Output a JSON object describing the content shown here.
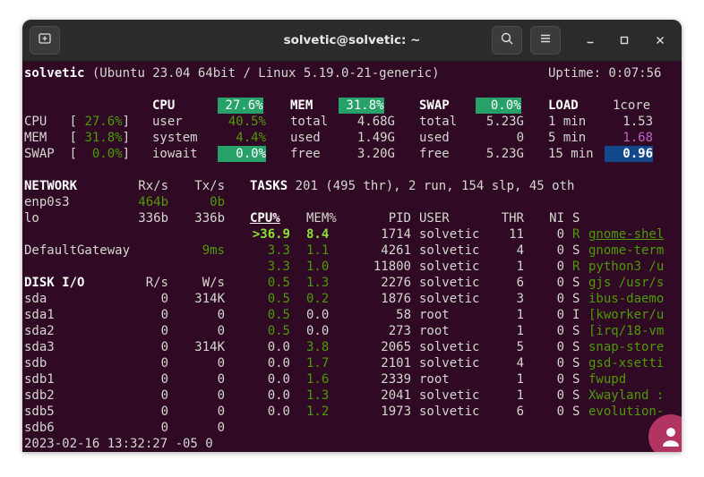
{
  "window": {
    "title": "solvetic@solvetic: ~",
    "new_tab_icon": "new-tab-icon",
    "search_icon": "search-icon",
    "menu_icon": "hamburger-menu-icon"
  },
  "header": {
    "host": "solvetic",
    "system": " (Ubuntu 23.04 64bit / Linux 5.19.0-21-generic)",
    "uptime": "Uptime: 0:07:56"
  },
  "quicklook": {
    "cpu_label": "CPU",
    "cpu_value": " 27.6%",
    "mem_label": "MEM",
    "mem_value": " 31.8%",
    "swap_label": "SWAP",
    "swap_value": "  0.0%",
    "bars": [
      {
        "label": "CPU ",
        "open": "[",
        "value": " 27.6%",
        "close": "]"
      },
      {
        "label": "MEM ",
        "open": "[",
        "value": " 31.8%",
        "close": "]"
      },
      {
        "label": "SWAP",
        "open": "[",
        "value": "  0.0%",
        "close": "]"
      }
    ],
    "cpu_rows": [
      {
        "label": "user",
        "value": "40.5%"
      },
      {
        "label": "system",
        "value": "4.4%"
      },
      {
        "label": "iowait",
        "value": "0.0%"
      }
    ],
    "mem_rows": [
      {
        "label": "total",
        "value": "4.68G"
      },
      {
        "label": "used",
        "value": "1.49G"
      },
      {
        "label": "free",
        "value": "3.20G"
      }
    ],
    "swap_rows": [
      {
        "label": "total",
        "value": "5.23G"
      },
      {
        "label": "used",
        "value": "0"
      },
      {
        "label": "free",
        "value": "5.23G"
      }
    ],
    "load_label": "LOAD",
    "load_cores": "1core",
    "load_rows": [
      {
        "label": "1 min",
        "value": "1.53"
      },
      {
        "label": "5 min",
        "value": "1.68"
      },
      {
        "label": "15 min",
        "value": "0.96"
      }
    ]
  },
  "network": {
    "title": "NETWORK",
    "rx_header": "Rx/s",
    "tx_header": "Tx/s",
    "rows": [
      {
        "iface": "enp0s3",
        "rx": "464b",
        "tx": "0b"
      },
      {
        "iface": "lo",
        "rx": "336b",
        "tx": "336b"
      }
    ],
    "gateway_label": "DefaultGateway",
    "gateway_value": "9ms"
  },
  "disk": {
    "title": "DISK I/O",
    "r_header": "R/s",
    "w_header": "W/s",
    "rows": [
      {
        "name": "sda",
        "r": "0",
        "w": "314K"
      },
      {
        "name": "sda1",
        "r": "0",
        "w": "0"
      },
      {
        "name": "sda2",
        "r": "0",
        "w": "0"
      },
      {
        "name": "sda3",
        "r": "0",
        "w": "314K"
      },
      {
        "name": "sdb",
        "r": "0",
        "w": "0"
      },
      {
        "name": "sdb1",
        "r": "0",
        "w": "0"
      },
      {
        "name": "sdb2",
        "r": "0",
        "w": "0"
      },
      {
        "name": "sdb5",
        "r": "0",
        "w": "0"
      },
      {
        "name": "sdb6",
        "r": "0",
        "w": "0"
      }
    ]
  },
  "tasks": {
    "summary_label": "TASKS",
    "summary": " 201 (495 thr), 2 run, 154 slp, 45 oth",
    "headers": {
      "cpu": "CPU%",
      "mem": "MEM%",
      "pid": "PID",
      "user": "USER",
      "thr": "THR",
      "ni": "NI",
      "s": "S"
    },
    "processes": [
      {
        "cpu": ">36.9",
        "mem": "8.4",
        "pid": "1714",
        "user": "solvetic",
        "thr": "11",
        "ni": "0",
        "s": "R",
        "cmd": "gnome-shel"
      },
      {
        "cpu": "3.3",
        "mem": "1.1",
        "pid": "4261",
        "user": "solvetic",
        "thr": "4",
        "ni": "0",
        "s": "S",
        "cmd": "gnome-term"
      },
      {
        "cpu": "3.3",
        "mem": "1.0",
        "pid": "11800",
        "user": "solvetic",
        "thr": "1",
        "ni": "0",
        "s": "R",
        "cmd": "python3 /u"
      },
      {
        "cpu": "0.5",
        "mem": "1.3",
        "pid": "2276",
        "user": "solvetic",
        "thr": "6",
        "ni": "0",
        "s": "S",
        "cmd": "gjs /usr/s"
      },
      {
        "cpu": "0.5",
        "mem": "0.2",
        "pid": "1876",
        "user": "solvetic",
        "thr": "3",
        "ni": "0",
        "s": "S",
        "cmd": "ibus-daemo"
      },
      {
        "cpu": "0.5",
        "mem": "0.0",
        "pid": "58",
        "user": "root",
        "thr": "1",
        "ni": "0",
        "s": "I",
        "cmd": "[kworker/u"
      },
      {
        "cpu": "0.5",
        "mem": "0.0",
        "pid": "273",
        "user": "root",
        "thr": "1",
        "ni": "0",
        "s": "S",
        "cmd": "[irq/18-vm"
      },
      {
        "cpu": "0.0",
        "mem": "3.8",
        "pid": "2065",
        "user": "solvetic",
        "thr": "5",
        "ni": "0",
        "s": "S",
        "cmd": "snap-store"
      },
      {
        "cpu": "0.0",
        "mem": "1.7",
        "pid": "2101",
        "user": "solvetic",
        "thr": "4",
        "ni": "0",
        "s": "S",
        "cmd": "gsd-xsetti"
      },
      {
        "cpu": "0.0",
        "mem": "1.6",
        "pid": "2339",
        "user": "root",
        "thr": "1",
        "ni": "0",
        "s": "S",
        "cmd": "fwupd"
      },
      {
        "cpu": "0.0",
        "mem": "1.3",
        "pid": "2041",
        "user": "solvetic",
        "thr": "1",
        "ni": "0",
        "s": "S",
        "cmd": "Xwayland :"
      },
      {
        "cpu": "0.0",
        "mem": "1.2",
        "pid": "1973",
        "user": "solvetic",
        "thr": "6",
        "ni": "0",
        "s": "S",
        "cmd": "evolution-"
      }
    ]
  },
  "footer": {
    "timestamp": "2023-02-16 13:32:27 -05 0"
  },
  "colors": {
    "terminal_bg": "#300a24",
    "text": "#d3d7cf",
    "green": "#4e9a06",
    "bright_green": "#8ae234",
    "bar_green": "#26a269",
    "magenta": "#c061cb",
    "load_blue": "#12488b"
  }
}
